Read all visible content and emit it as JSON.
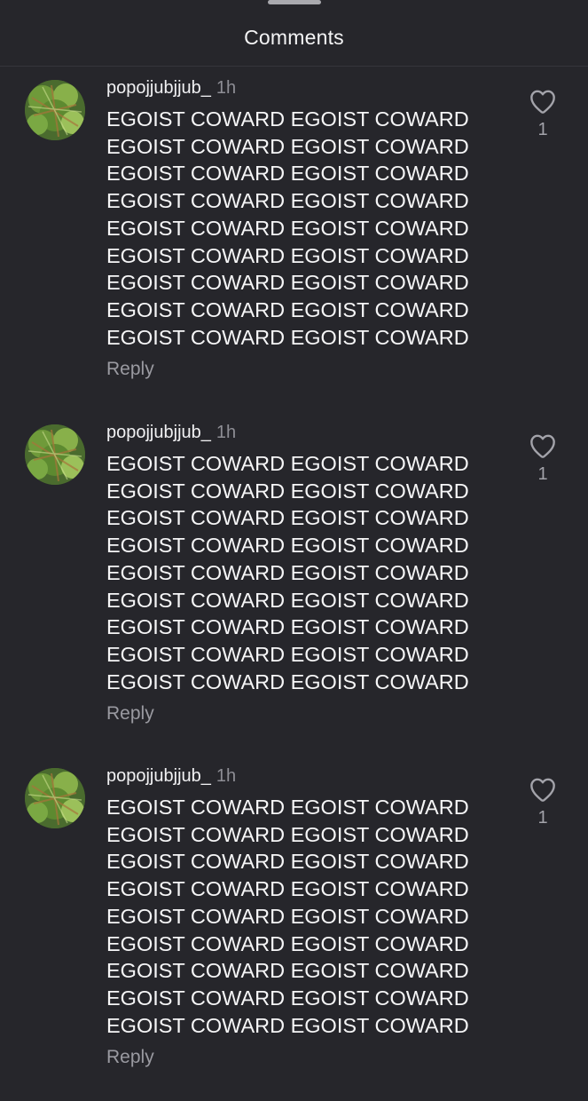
{
  "header": {
    "title": "Comments"
  },
  "comments": [
    {
      "username": "popojjubjjub_",
      "time": "1h",
      "lines": [
        "EGOIST COWARD EGOIST COWARD",
        "EGOIST COWARD EGOIST COWARD",
        "EGOIST COWARD EGOIST COWARD",
        "EGOIST COWARD EGOIST COWARD",
        "EGOIST COWARD EGOIST COWARD",
        "EGOIST COWARD EGOIST COWARD",
        "EGOIST COWARD EGOIST COWARD",
        "EGOIST COWARD EGOIST COWARD",
        "EGOIST COWARD EGOIST COWARD"
      ],
      "reply_label": "Reply",
      "like_count": "1",
      "like_icon": "heart-outline-icon"
    },
    {
      "username": "popojjubjjub_",
      "time": "1h",
      "lines": [
        "EGOIST COWARD EGOIST COWARD",
        "EGOIST COWARD EGOIST COWARD",
        "EGOIST COWARD EGOIST COWARD",
        "EGOIST COWARD EGOIST COWARD",
        "EGOIST COWARD EGOIST COWARD",
        "EGOIST COWARD EGOIST COWARD",
        "EGOIST COWARD EGOIST COWARD",
        "EGOIST COWARD EGOIST COWARD",
        "EGOIST COWARD EGOIST COWARD"
      ],
      "reply_label": "Reply",
      "like_count": "1",
      "like_icon": "heart-outline-icon"
    },
    {
      "username": "popojjubjjub_",
      "time": "1h",
      "lines": [
        "EGOIST COWARD EGOIST COWARD",
        "EGOIST COWARD EGOIST COWARD",
        "EGOIST COWARD EGOIST COWARD",
        "EGOIST COWARD EGOIST COWARD",
        "EGOIST COWARD EGOIST COWARD",
        "EGOIST COWARD EGOIST COWARD",
        "EGOIST COWARD EGOIST COWARD",
        "EGOIST COWARD EGOIST COWARD",
        "EGOIST COWARD EGOIST COWARD"
      ],
      "reply_label": "Reply",
      "like_count": "1",
      "like_icon": "heart-outline-icon"
    }
  ],
  "colors": {
    "background": "#26262b",
    "text": "#f6f6f7",
    "secondary_text": "#8e8e95"
  }
}
